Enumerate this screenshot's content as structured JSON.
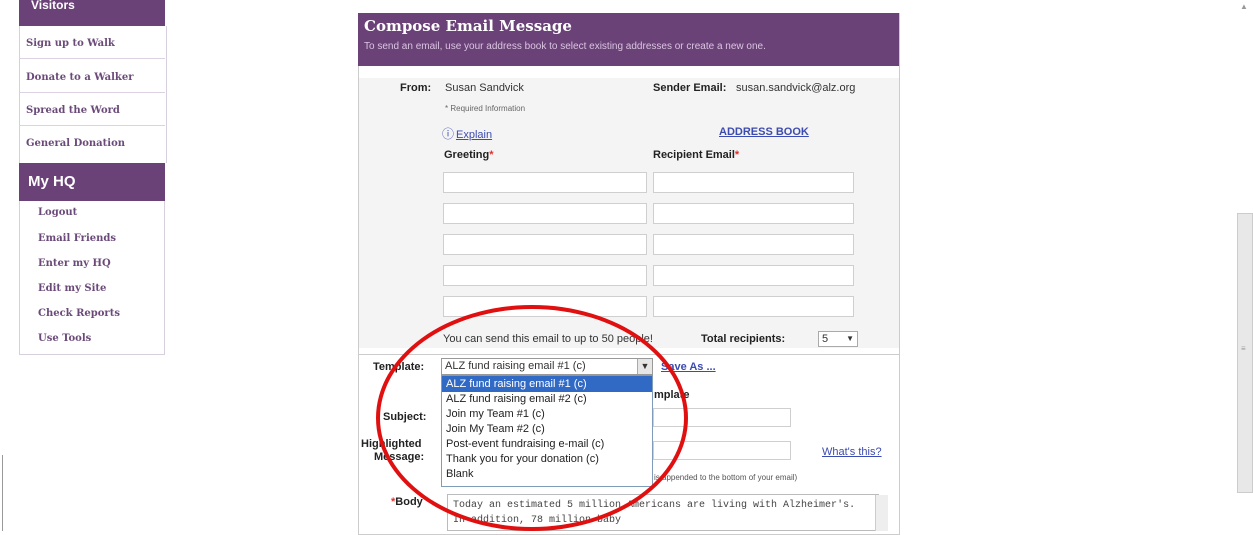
{
  "sidebar": {
    "top_label": "Visitors",
    "links": [
      "Sign up to Walk",
      "Donate to a Walker",
      "Spread the Word",
      "General Donation"
    ],
    "myhq_title": "My HQ",
    "hq_links": [
      "Logout",
      "Email Friends",
      "Enter my HQ",
      "Edit my Site",
      "Check Reports",
      "Use Tools"
    ]
  },
  "compose": {
    "title": "Compose Email Message",
    "subtitle": "To send an email, use your address book to select existing addresses or create a new one.",
    "from_label": "From:",
    "from_value": "Susan Sandvick",
    "sender_email_label": "Sender Email:",
    "sender_email_value": "susan.sandvick@alz.org",
    "required_info": "* Required Information",
    "explain_link": "Explain",
    "address_book_link": "ADDRESS BOOK",
    "greeting_label": "Greeting",
    "recipient_label": "Recipient Email",
    "required_star": "*",
    "send_note": "You can send this email to up to 50 people!",
    "total_recipients_label": "Total recipients:",
    "total_recipients_value": "5",
    "template_label": "Template:",
    "template_selected": "ALZ fund raising email #1 (c)",
    "save_as_link": "Save As ...",
    "template_options": [
      "ALZ fund raising email #1 (c)",
      "ALZ fund raising email #2 (c)",
      "Join my Team #1 (c)",
      "Join My Team #2 (c)",
      "Post-event fundraising e-mail (c)",
      "Thank you for your donation (c)",
      "Blank"
    ],
    "behind_template_text": "mplate",
    "subject_label": "Subject:",
    "highlighted_label_1": "Highlighted",
    "highlighted_label_2": "Message:",
    "whats_this_link": "What's this?",
    "appended_note": "is appended to the bottom of your email)",
    "body_label": "Body",
    "body_text": "Today an estimated 5 million Americans are living with Alzheimer's. In addition, 78 million baby"
  },
  "colors": {
    "brand_purple": "#6b4278",
    "highlight_red": "#e01010",
    "link_blue": "#3c4bb0"
  }
}
